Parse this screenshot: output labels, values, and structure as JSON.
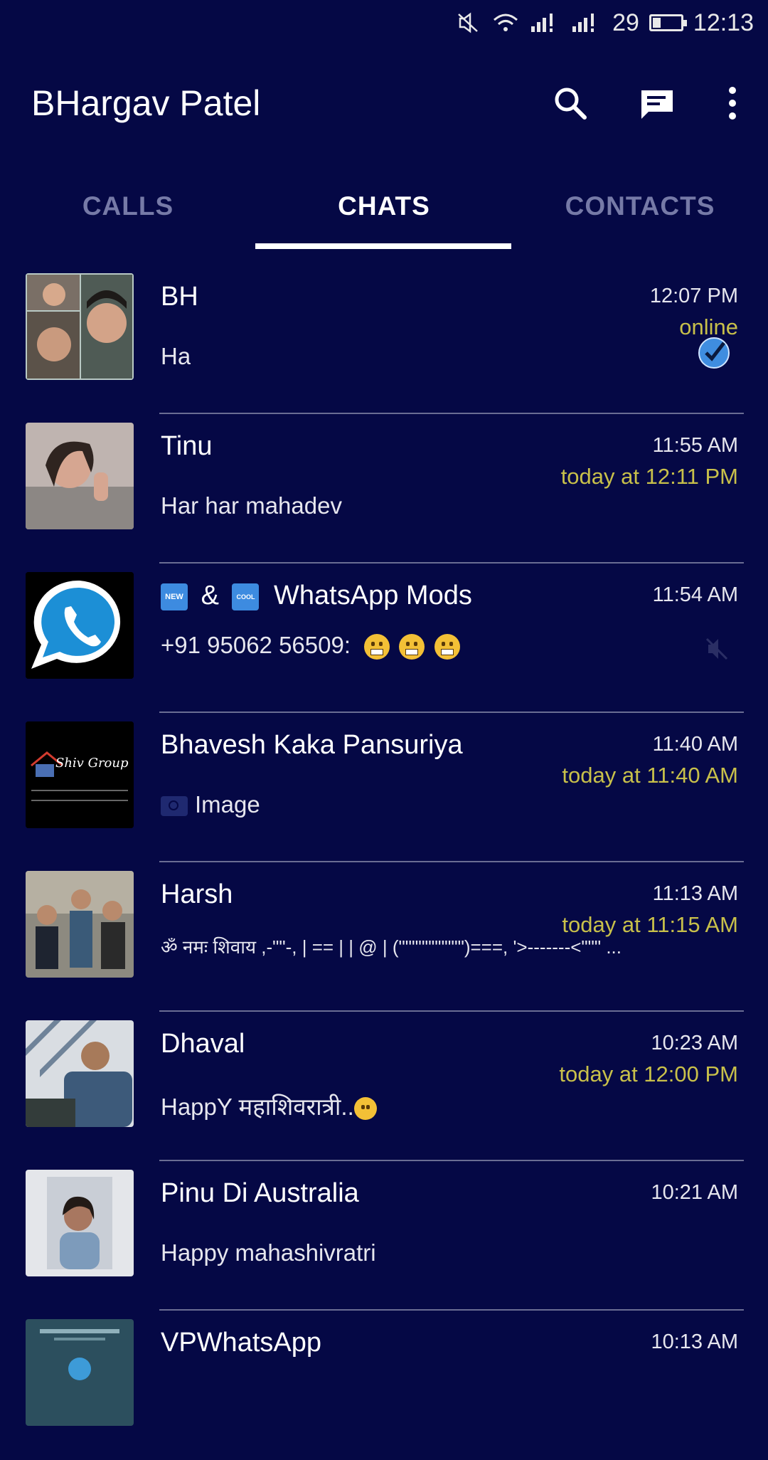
{
  "status_bar": {
    "signal_text": " ",
    "battery_percent": "29",
    "battery_level": 0.29,
    "time": "12:13"
  },
  "app_bar": {
    "title": "BHargav Patel",
    "icons": [
      "search-icon",
      "new-chat-icon",
      "more-options-icon"
    ]
  },
  "tabs": [
    {
      "label": "CALLS",
      "active": false
    },
    {
      "label": "CHATS",
      "active": true
    },
    {
      "label": "CONTACTS",
      "active": false
    }
  ],
  "chats": [
    {
      "name": "BH",
      "message": "Ha",
      "time": "12:07 PM",
      "seen": "online",
      "status_icon": "blue-check-icon"
    },
    {
      "name": "Tinu",
      "message": "Har har mahadev",
      "time": "11:55 AM",
      "seen": "today at 12:11 PM"
    },
    {
      "name_badge_1": "NEW",
      "name_joiner": "&",
      "name_badge_2": "COOL",
      "name": "WhatsApp Mods",
      "message": "+91 95062 56509:",
      "time": "11:54 AM",
      "status_icon": "mute-icon"
    },
    {
      "name": "Bhavesh Kaka Pansuriya",
      "message": "Image",
      "time": "11:40 AM",
      "seen": "today at 11:40 AM",
      "message_icon": "camera-icon"
    },
    {
      "name": "Harsh",
      "message": "ॐ नमः शिवाय ,-\"\"-, | == | | @ | (\"\"\"\"\"\"\"\"\"\")===, '>-------<\"\"\" ...",
      "time": "11:13 AM",
      "seen": "today at 11:15 AM"
    },
    {
      "name": "Dhaval",
      "message": "HappY महाशिवरात्री..",
      "time": "10:23 AM",
      "seen": "today at 12:00 PM"
    },
    {
      "name": "Pinu Di Australia",
      "message": "Happy mahashivratri",
      "time": "10:21 AM"
    },
    {
      "name": "VPWhatsApp",
      "message": "",
      "time": "10:13 AM"
    }
  ],
  "colors": {
    "background": "#050845",
    "seen_text": "#c8c04a",
    "inactive_tab": "#767aa7"
  }
}
